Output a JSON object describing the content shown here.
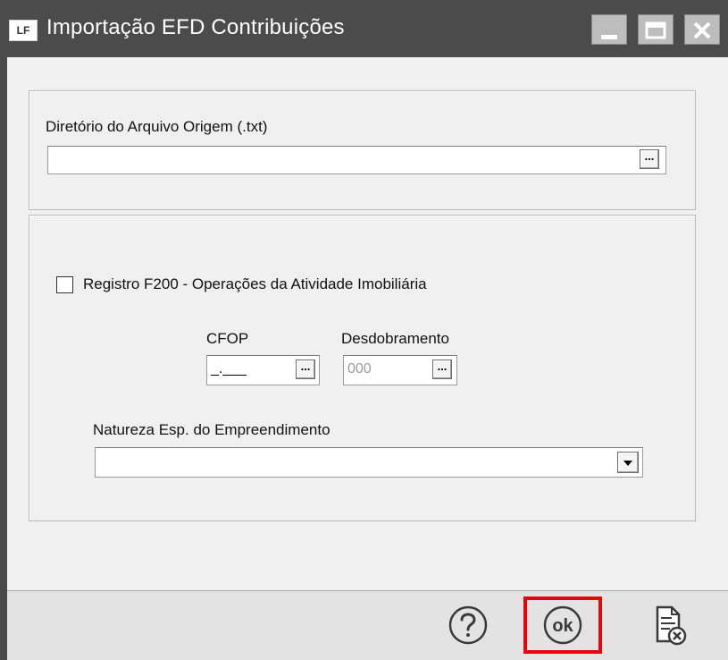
{
  "window": {
    "app_icon_text": "LF",
    "title": "Importação EFD Contribuições",
    "controls": [
      "minimize-icon",
      "maximize-icon",
      "close-icon"
    ]
  },
  "origin_group": {
    "label": "Diretório do Arquivo Origem (.txt)",
    "path_value": "",
    "browse_label": "..."
  },
  "f200_group": {
    "checkbox_label": "Registro F200 - Operações da Atividade Imobiliária",
    "checked": false,
    "cfop": {
      "label": "CFOP",
      "value": "_.___",
      "browse_label": "..."
    },
    "desdobramento": {
      "label": "Desdobramento",
      "value": "000",
      "browse_label": "..."
    },
    "natureza": {
      "label": "Natureza Esp. do Empreendimento",
      "selected": ""
    }
  },
  "footer": {
    "buttons": [
      "help-icon",
      "ok-icon",
      "cancel-document-icon"
    ],
    "ok_text": "ok",
    "highlight_color": "#e8000b"
  }
}
